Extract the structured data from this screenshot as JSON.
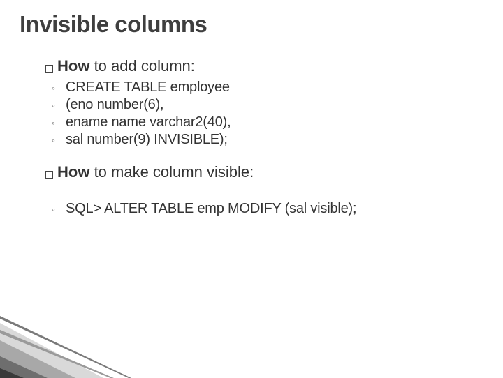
{
  "title": "Invisible columns",
  "section1": {
    "bold": "How",
    "rest": " to add column:",
    "lines": [
      "CREATE TABLE employee",
      " (eno number(6),",
      "  ename name varchar2(40),",
      "  sal number(9) INVISIBLE);"
    ]
  },
  "section2": {
    "bold": "How",
    "rest": " to make column visible:",
    "lines": [
      "SQL> ALTER TABLE emp MODIFY (sal visible);"
    ]
  }
}
